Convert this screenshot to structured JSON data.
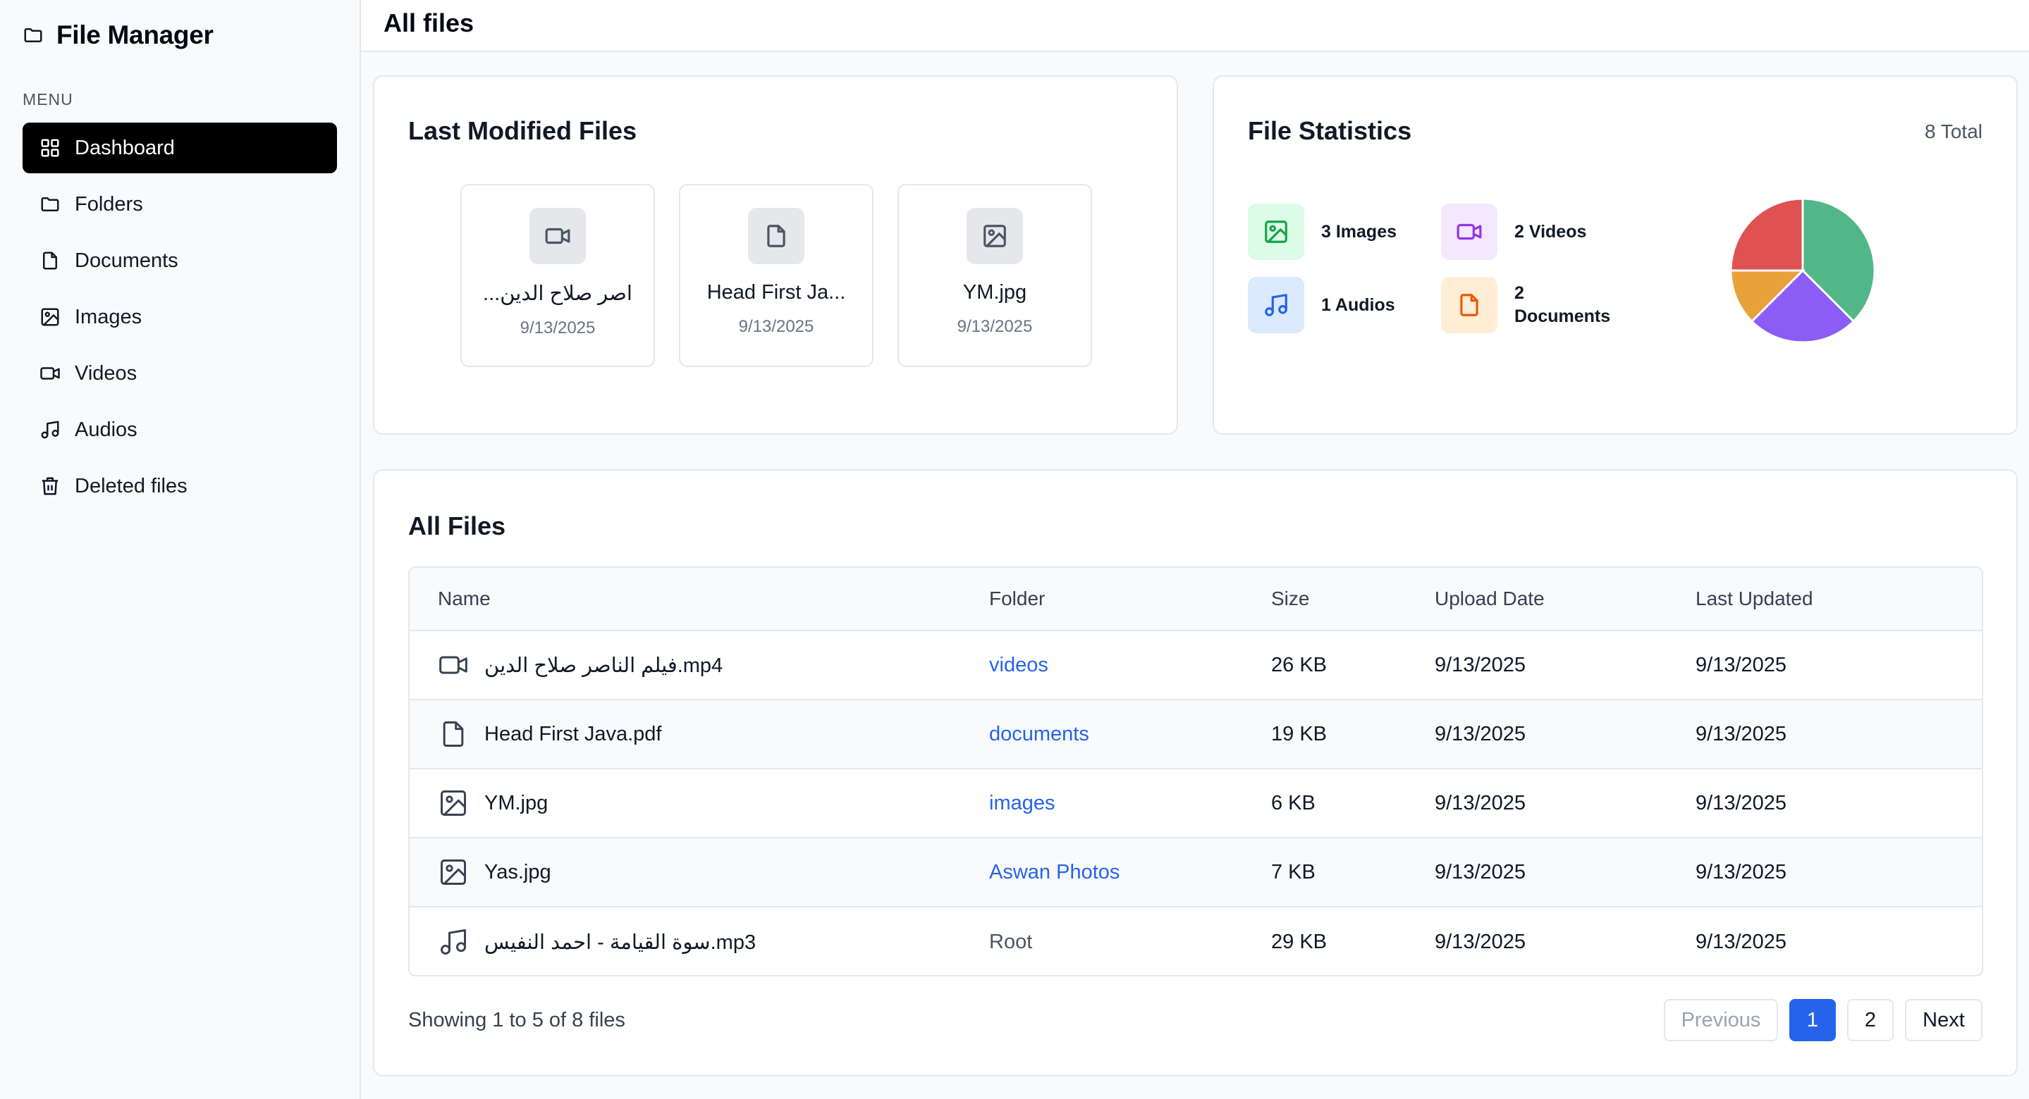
{
  "app": {
    "title": "File Manager"
  },
  "sidebar": {
    "menu_label": "MENU",
    "items": [
      {
        "label": "Dashboard",
        "icon": "grid-icon",
        "active": true
      },
      {
        "label": "Folders",
        "icon": "folder-icon"
      },
      {
        "label": "Documents",
        "icon": "document-icon"
      },
      {
        "label": "Images",
        "icon": "image-icon"
      },
      {
        "label": "Videos",
        "icon": "video-icon"
      },
      {
        "label": "Audios",
        "icon": "music-icon"
      },
      {
        "label": "Deleted files",
        "icon": "trash-icon"
      }
    ]
  },
  "header": {
    "title": "All files"
  },
  "last_modified": {
    "title": "Last Modified Files",
    "files": [
      {
        "name": "فيلم الناصر صلاح الدين.mp4",
        "display_name": "...اصر صلاح الدين",
        "date": "9/13/2025",
        "icon": "video-icon"
      },
      {
        "name": "Head First Java.pdf",
        "display_name": "Head First Ja...",
        "date": "9/13/2025",
        "icon": "document-icon"
      },
      {
        "name": "YM.jpg",
        "display_name": "YM.jpg",
        "date": "9/13/2025",
        "icon": "image-icon"
      }
    ]
  },
  "stats": {
    "title": "File Statistics",
    "total": "8 Total",
    "items": [
      {
        "label": "3 Images",
        "count": 3,
        "icon": "image-icon",
        "color": "#16a34a",
        "bg": "#dcfce7"
      },
      {
        "label": "2 Videos",
        "count": 2,
        "icon": "video-icon",
        "color": "#9333ea",
        "bg": "#f3e8ff"
      },
      {
        "label": "1 Audios",
        "count": 1,
        "icon": "music-icon",
        "color": "#2563eb",
        "bg": "#dbeafe"
      },
      {
        "label": "2 Documents",
        "count": 2,
        "icon": "document-icon",
        "color": "#ea580c",
        "bg": "#ffedd5"
      }
    ]
  },
  "chart_data": {
    "type": "pie",
    "categories": [
      "Images",
      "Videos",
      "Audios",
      "Documents"
    ],
    "values": [
      3,
      2,
      1,
      2
    ],
    "colors": [
      "#52b788",
      "#8b5cf6",
      "#e9a23b",
      "#e05252"
    ]
  },
  "all_files": {
    "title": "All Files",
    "columns": [
      "Name",
      "Folder",
      "Size",
      "Upload Date",
      "Last Updated"
    ],
    "rows": [
      {
        "icon": "video-icon",
        "name": "فيلم الناصر صلاح الدين.mp4",
        "folder": "videos",
        "folder_is_link": true,
        "size": "26 KB",
        "upload": "9/13/2025",
        "updated": "9/13/2025"
      },
      {
        "icon": "document-icon",
        "name": "Head First Java.pdf",
        "folder": "documents",
        "folder_is_link": true,
        "size": "19 KB",
        "upload": "9/13/2025",
        "updated": "9/13/2025"
      },
      {
        "icon": "image-icon",
        "name": "YM.jpg",
        "folder": "images",
        "folder_is_link": true,
        "size": "6 KB",
        "upload": "9/13/2025",
        "updated": "9/13/2025"
      },
      {
        "icon": "image-icon",
        "name": "Yas.jpg",
        "folder": "Aswan Photos",
        "folder_is_link": true,
        "size": "7 KB",
        "upload": "9/13/2025",
        "updated": "9/13/2025"
      },
      {
        "icon": "music-icon",
        "name": "سوة القيامة - احمد النفيس.mp3",
        "folder": "Root",
        "folder_is_link": false,
        "size": "29 KB",
        "upload": "9/13/2025",
        "updated": "9/13/2025"
      }
    ],
    "showing": "Showing 1 to 5 of 8 files",
    "pagination": {
      "previous": "Previous",
      "pages": [
        "1",
        "2"
      ],
      "current": "1",
      "next": "Next"
    }
  }
}
